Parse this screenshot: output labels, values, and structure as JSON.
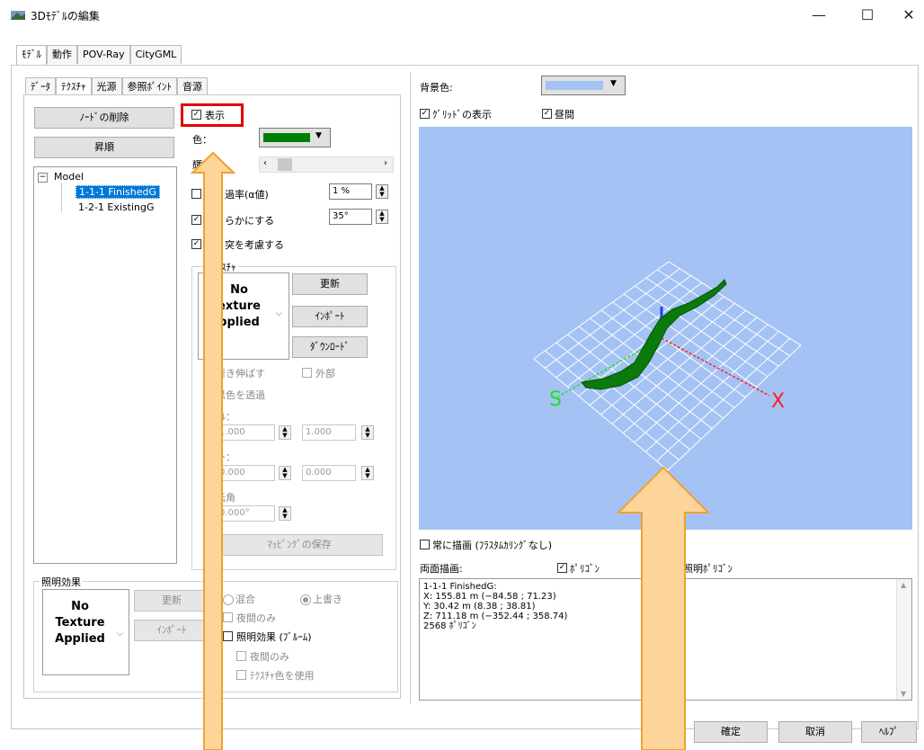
{
  "window": {
    "title": "3Dﾓﾃﾞﾙの編集",
    "minimize": "—",
    "maximize": "☐",
    "close": "✕"
  },
  "main_tabs": [
    "ﾓﾃﾞﾙ",
    "動作",
    "POV-Ray",
    "CityGML"
  ],
  "sub_tabs": [
    "ﾃﾞｰﾀ",
    "ﾃｸｽﾁｬ",
    "光源",
    "参照ﾎﾟｲﾝﾄ",
    "音源"
  ],
  "left": {
    "delete_node": "ﾉｰﾄﾞの削除",
    "ascending": "昇順",
    "tree": {
      "root": "Model",
      "items": [
        "1-1-1 FinishedG",
        "1-2-1 ExistingG"
      ]
    }
  },
  "props": {
    "show": "表示",
    "color_label": "色：",
    "brightness_label": "輝",
    "transparency": "過率(α値)",
    "transparency_value": "1 %",
    "smooth": "らかにする",
    "smooth_value": "35°",
    "collision": "突を考慮する",
    "colors": {
      "model_color": "#008000",
      "bg_color": "#a4c2f4"
    }
  },
  "texture": {
    "legend": "ｽﾁｬ",
    "preview": [
      "No",
      "exture",
      "pplied"
    ],
    "update": "更新",
    "import": "ｲﾝﾎﾟｰﾄ",
    "download": "ﾀﾞｳﾝﾛｰﾄﾞ",
    "stretch": "引き伸ばす",
    "external": "外部",
    "transparent_black": "黒色を透過",
    "scale_label": "ｰﾙ：",
    "scale_x": "1.000",
    "scale_y": "1.000",
    "offset_label": "ｯﾄ：",
    "offset_x": "0.000",
    "offset_y": "0.000",
    "rotation_label": "転角",
    "rotation": "0.000°",
    "save_mapping": "ﾏｯﾋﾟﾝｸﾞの保存"
  },
  "lighting": {
    "legend": "照明効果",
    "preview": [
      "No",
      "Texture",
      "Applied"
    ],
    "update": "更新",
    "import": "ｲﾝﾎﾟｰﾄ",
    "mix": "混合",
    "overwrite": "上書き",
    "night_only": "夜間のみ",
    "bloom": "照明効果 (ﾌﾞﾙｰﾑ)",
    "bloom_night_only": "夜間のみ",
    "use_texture_color": "ﾃｸｽﾁｬ色を使用"
  },
  "right": {
    "bg_label": "背景色:",
    "grid_show": "ｸﾞﾘｯﾄﾞの表示",
    "daytime": "昼間",
    "always_draw": "常に描画 (ﾌﾗｽﾀﾑｶﾘﾝｸﾞなし)",
    "double_side": "両面描画:",
    "polygon": "ﾎﾟﾘｺﾞﾝ",
    "lit_polygon": "照明ﾎﾟﾘｺﾞﾝ",
    "axis_s": "S",
    "axis_x": "X",
    "info": [
      "1-1-1 FinishedG:",
      "X: 155.81 m (−84.58 ; 71.23)",
      "Y: 30.42 m (8.38 ; 38.81)",
      "Z: 711.18 m (−352.44 ; 358.74)",
      "2568 ﾎﾟﾘｺﾞﾝ"
    ]
  },
  "footer": {
    "ok": "確定",
    "cancel": "取消",
    "help": "ﾍﾙﾌﾟ"
  }
}
